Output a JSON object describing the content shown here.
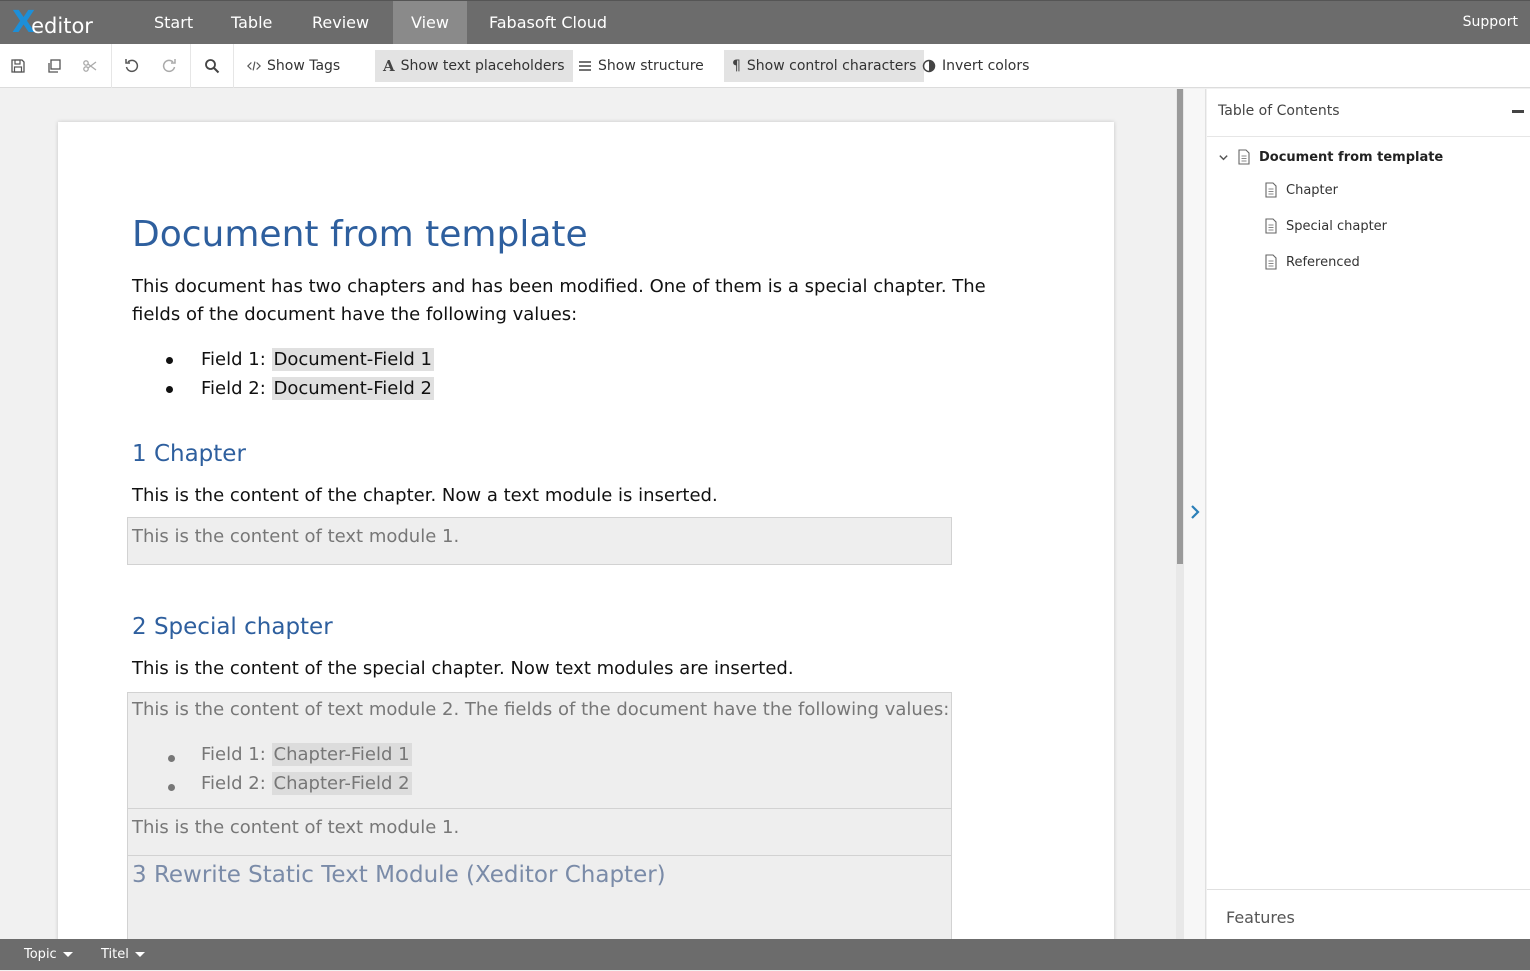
{
  "app": {
    "logo_x": "X",
    "logo_rest": "editor",
    "support": "Support"
  },
  "menu": [
    "Start",
    "Table",
    "Review",
    "View",
    "Fabasoft Cloud"
  ],
  "menu_active": "View",
  "toolbar": {
    "icons": [
      "save-icon",
      "duplicate-icon",
      "scissors-icon",
      "undo-icon",
      "redo-icon",
      "search-icon"
    ],
    "show_tags": "Show Tags",
    "show_text_placeholders": "Show text placeholders",
    "show_structure": "Show structure",
    "show_control_characters": "Show control characters",
    "invert_colors": "Invert colors"
  },
  "document": {
    "title": "Document from template",
    "intro_line1": "This document has two chapters and has been modified. One of them is a special chapter. The",
    "intro_line2": "fields of the document have the following values:",
    "field1_label": "Field 1: ",
    "field1_value": "Document-Field 1",
    "field2_label": "Field 2: ",
    "field2_value": "Document-Field 2",
    "chapter1_heading": "1 Chapter",
    "chapter1_text": "This is the content of the chapter. Now a text module is inserted.",
    "module1_text": "This is the content of text module 1.",
    "chapter2_heading": "2 Special chapter",
    "chapter2_text": "This is the content of the special chapter. Now text modules are inserted.",
    "module2_text": "This is the content of text module 2. The fields of the document have the following values:",
    "module2_field1_label": "Field 1: ",
    "module2_field1_value": "Chapter-Field 1",
    "module2_field2_label": "Field 2: ",
    "module2_field2_value": "Chapter-Field 2",
    "module3_text": "This is the content of text module 1.",
    "chapter3_heading": "3 Rewrite Static Text Module (Xeditor Chapter)"
  },
  "toc": {
    "header": "Table of Contents",
    "root": "Document from template",
    "items": [
      "Chapter",
      "Special chapter",
      "Referenced"
    ]
  },
  "features": "Features",
  "bottombar": {
    "topic": "Topic",
    "titel": "Titel"
  },
  "colors": {
    "accent": "#2e5f9e",
    "logo_blue": "#1d8fd8",
    "bars": "#6c6c6c"
  }
}
